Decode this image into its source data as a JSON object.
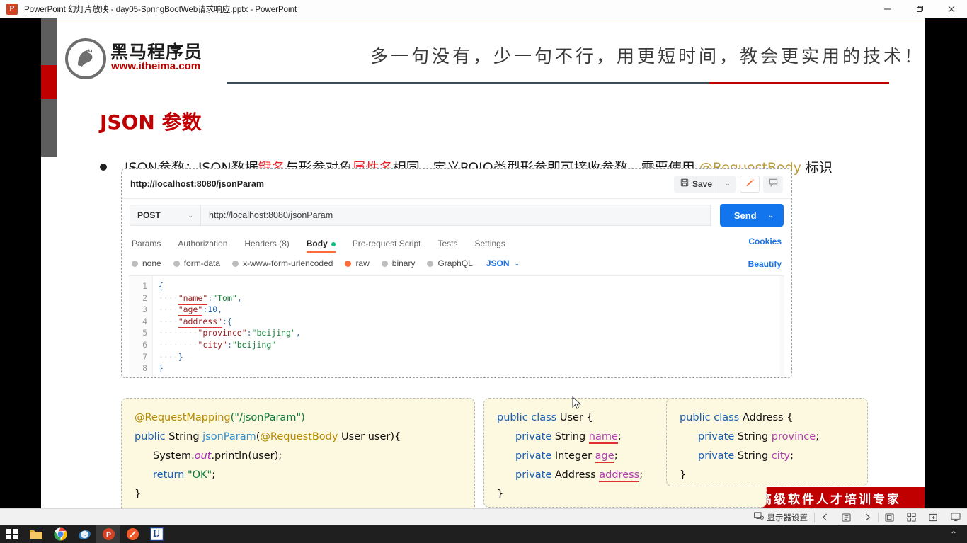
{
  "window": {
    "app_icon": "powerpoint-icon",
    "title": "PowerPoint 幻灯片放映  -  day05-SpringBootWeb请求响应.pptx - PowerPoint",
    "minimize_label": "最小化",
    "restore_label": "还原",
    "close_label": "关闭"
  },
  "slide": {
    "logo": {
      "brand_cn": "黑马程序员",
      "brand_url": "www.itheima.com"
    },
    "slogan": "多一句没有，少一句不行，用更短时间，教会更实用的技术！",
    "title": "JSON 参数",
    "bullet": {
      "seg1": "JSON参数：JSON数据",
      "seg2_red": "键名",
      "seg3": "与形参对象",
      "seg4_red": "属性名",
      "seg5": "相同，定义POJO类型形参即可接收参数，需要使用 ",
      "seg6_gold": "@RequestBody",
      "seg7": " 标识"
    },
    "banner_text": "高级软件人才培训专家"
  },
  "postman": {
    "tab_name": "http://localhost:8080/jsonParam",
    "save_label": "Save",
    "save_caret": "⌄",
    "pencil_icon": "pencil-icon",
    "comment_icon": "comment-icon",
    "method": "POST",
    "method_caret": "⌄",
    "url": "http://localhost:8080/jsonParam",
    "send_label": "Send",
    "send_caret": "⌄",
    "tabs": [
      {
        "label": "Params",
        "active": false
      },
      {
        "label": "Authorization",
        "active": false
      },
      {
        "label": "Headers (8)",
        "active": false
      },
      {
        "label": "Body",
        "active": true,
        "dot": true
      },
      {
        "label": "Pre-request Script",
        "active": false
      },
      {
        "label": "Tests",
        "active": false
      },
      {
        "label": "Settings",
        "active": false
      }
    ],
    "cookies_link": "Cookies",
    "beautify_link": "Beautify",
    "body_types": [
      {
        "label": "none",
        "checked": false
      },
      {
        "label": "form-data",
        "checked": false
      },
      {
        "label": "x-www-form-urlencoded",
        "checked": false
      },
      {
        "label": "raw",
        "checked": true
      },
      {
        "label": "binary",
        "checked": false
      },
      {
        "label": "GraphQL",
        "checked": false
      }
    ],
    "format_select": "JSON",
    "format_caret": "⌄",
    "editor": {
      "line_numbers": [
        "1",
        "2",
        "3",
        "4",
        "5",
        "6",
        "7",
        "8"
      ],
      "lines": [
        "{",
        "    \"name\":\"Tom\",",
        "    \"age\":10,",
        "    \"address\":{",
        "        \"province\":\"beijing\",",
        "        \"city\":\"beijing\"",
        "    }",
        "}"
      ]
    }
  },
  "code_boxes": {
    "controller": {
      "l1_anno": "@RequestMapping",
      "l1_rest": "(\"/jsonParam\")",
      "l2": "public String jsonParam(@RequestBody User user){",
      "l3": "System.out.println(user);",
      "l4": "return \"OK\";",
      "l5": "}"
    },
    "user_class": {
      "l1": "public class User {",
      "l2": "private String name;",
      "l3": "private Integer age;",
      "l4": "private Address address;",
      "l5": "}"
    },
    "address_class": {
      "l1": "public class Address {",
      "l2": "private String province;",
      "l3": "private String city;",
      "l4": "}"
    }
  },
  "statusbar": {
    "display_settings": "显示器设置",
    "prev_icon": "chevron-left-icon",
    "slide_counter_icon": "slide-counter-icon",
    "next_icon": "chevron-right-icon",
    "pen_icon": "pen-tools-icon",
    "grid_icon": "grid-view-icon",
    "zoom_icon": "zoom-icon",
    "presenter_icon": "presenter-view-icon"
  },
  "taskbar": {
    "items": [
      {
        "name": "start-button",
        "icon": "windows-logo-icon"
      },
      {
        "name": "file-explorer",
        "icon": "folder-icon"
      },
      {
        "name": "google-chrome",
        "icon": "chrome-icon"
      },
      {
        "name": "internet-explorer",
        "icon": "ie-icon"
      },
      {
        "name": "powerpoint",
        "icon": "powerpoint-icon",
        "active": true
      },
      {
        "name": "app-orange",
        "icon": "orange-circle-icon"
      },
      {
        "name": "intellij-idea",
        "icon": "idea-icon"
      }
    ],
    "expand_caret": "⌃"
  },
  "colors": {
    "brand_red": "#c00000",
    "accent_orange": "#ff6c37",
    "link_blue": "#1a73e8",
    "send_blue": "#1275ed",
    "code_bg": "#fdf8e0"
  }
}
